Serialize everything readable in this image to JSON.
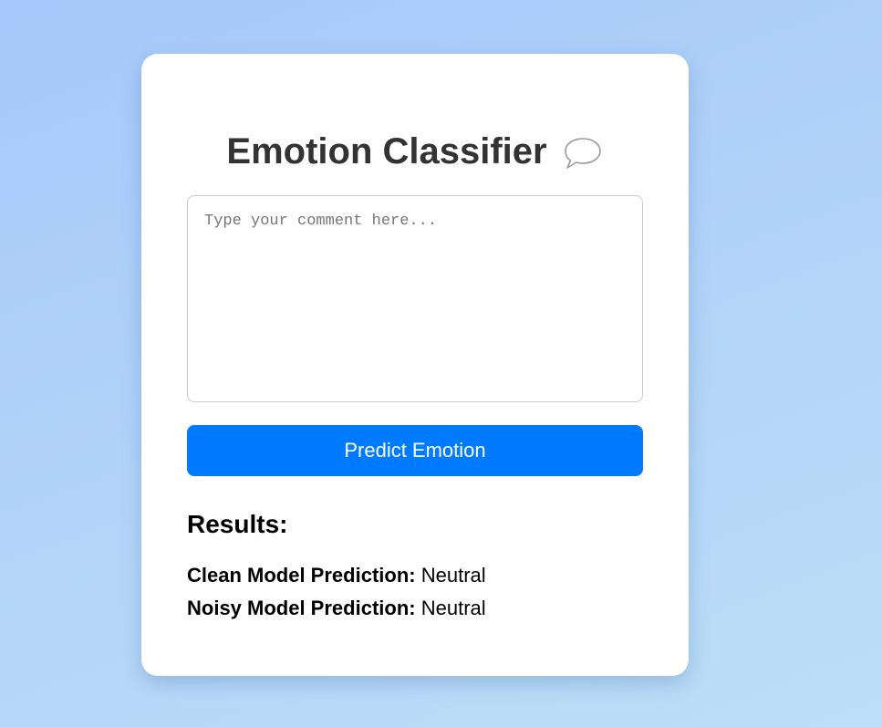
{
  "header": {
    "title": "Emotion Classifier",
    "icon": "speech-bubble-icon"
  },
  "input": {
    "value": "",
    "placeholder": "Type your comment here..."
  },
  "predict_button": {
    "label": "Predict Emotion",
    "color": "#007bff"
  },
  "results": {
    "heading": "Results:",
    "items": [
      {
        "label": "Clean Model Prediction:",
        "value": "Neutral"
      },
      {
        "label": "Noisy Model Prediction:",
        "value": "Neutral"
      }
    ]
  },
  "colors": {
    "title": "#333333",
    "card": "#ffffff",
    "accent": "#007bff"
  }
}
